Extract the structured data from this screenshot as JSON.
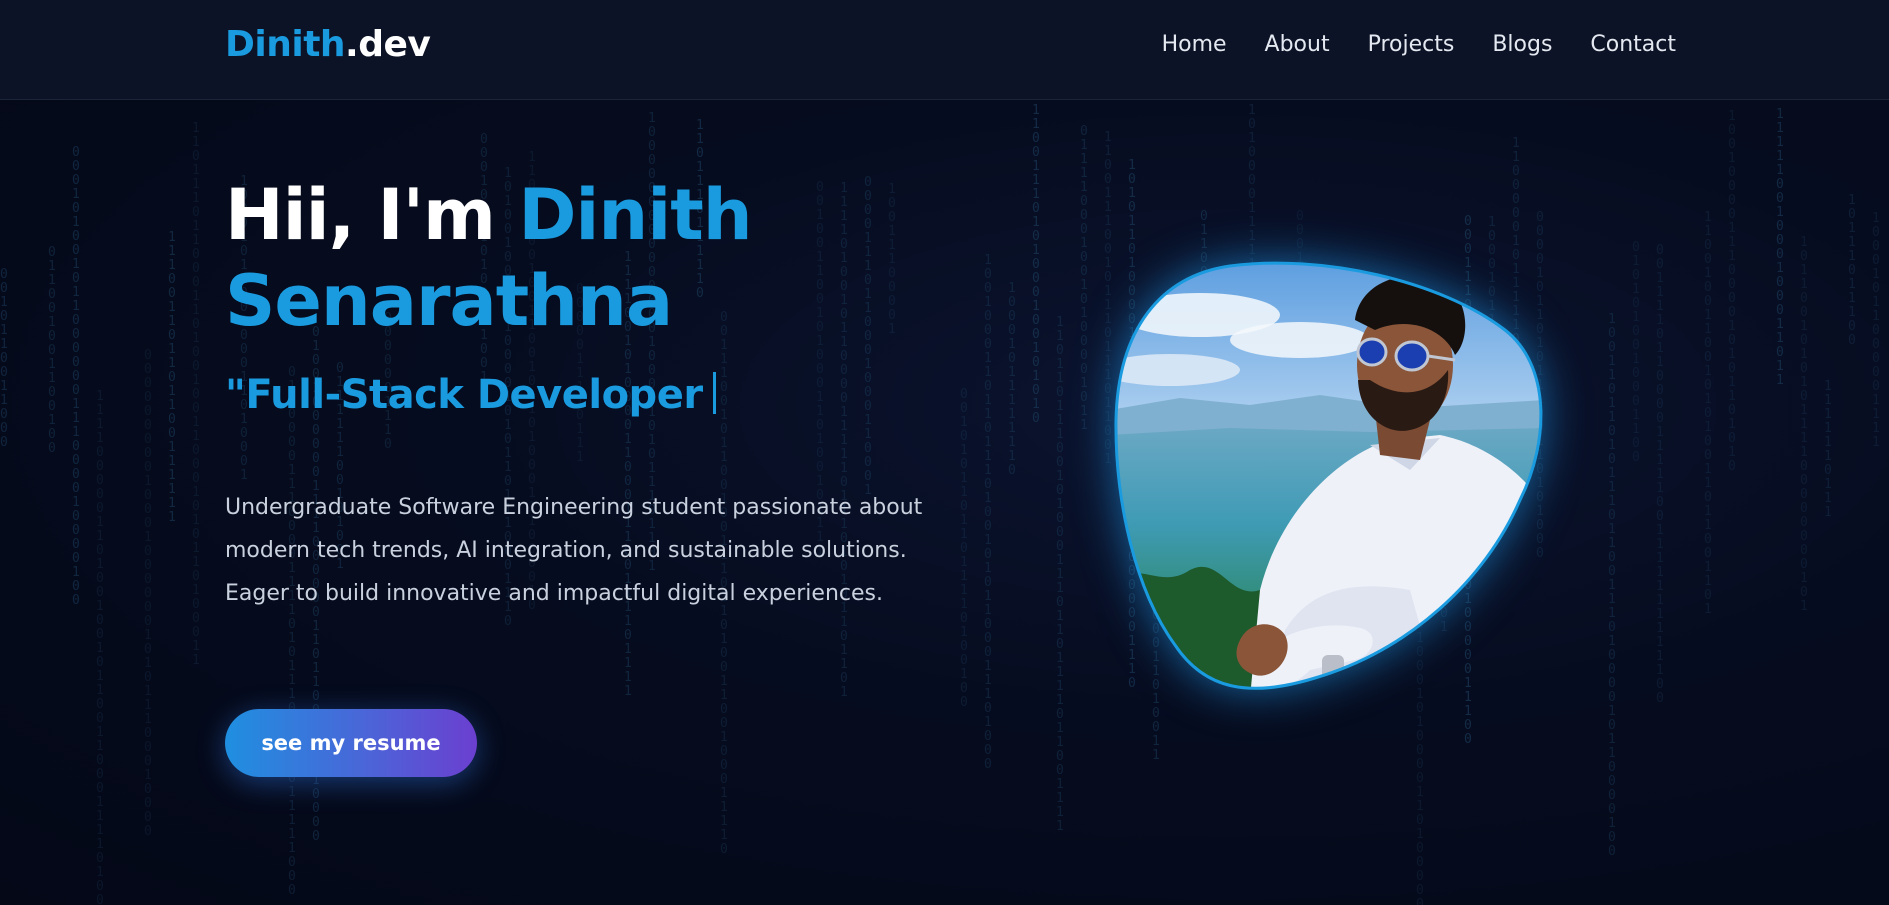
{
  "header": {
    "logo_accent": "Dinith",
    "logo_rest": ".dev",
    "nav": [
      "Home",
      "About",
      "Projects",
      "Blogs",
      "Contact"
    ]
  },
  "hero": {
    "greeting": "Hii, I'm ",
    "name_first": "Dinith",
    "name_last": "Senarathna",
    "role": "\"Full-Stack Developer",
    "bio": "Undergraduate Software Engineering student passionate about modern tech trends, AI integration, and sustainable solutions. Eager to build innovative and impactful digital experiences.",
    "button_label": "see my resume"
  },
  "colors": {
    "accent": "#1a9be0",
    "background": "#050a1a",
    "header_bg": "#0d1326",
    "button_gradient_start": "#1f8fe0",
    "button_gradient_end": "#6b3fd0"
  },
  "icons": {
    "text_cursor": "caret-icon"
  }
}
